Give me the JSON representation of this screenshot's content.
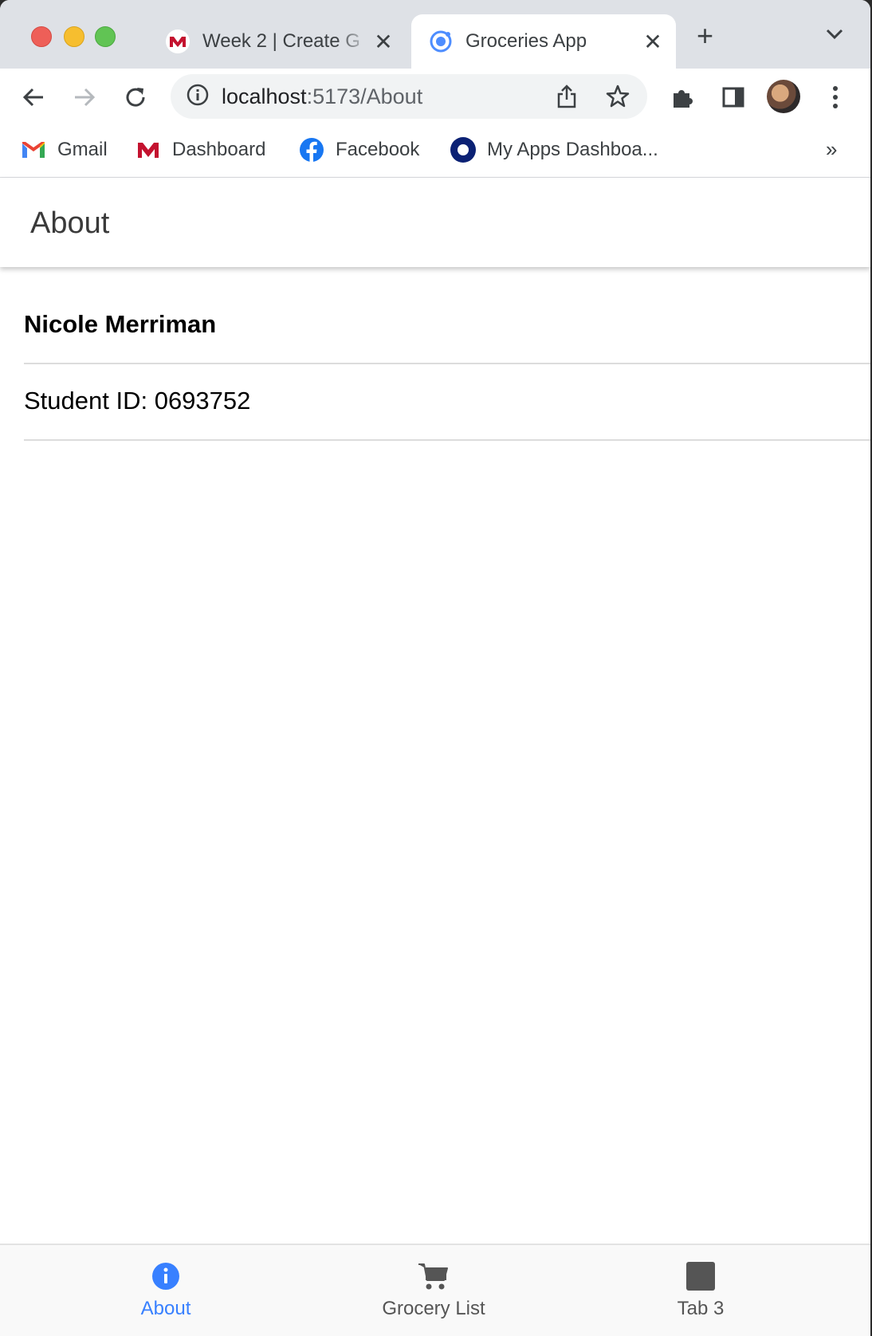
{
  "browser": {
    "tabs": [
      {
        "title": "Week 2 | Create G",
        "favicon": "mheducation-icon",
        "active": false
      },
      {
        "title": "Groceries App",
        "favicon": "ionic-icon",
        "active": true
      }
    ],
    "url": {
      "host": "localhost",
      "rest": ":5173/About"
    },
    "bookmarks": [
      {
        "label": "Gmail",
        "icon": "gmail-icon"
      },
      {
        "label": "Dashboard",
        "icon": "mheducation-icon"
      },
      {
        "label": "Facebook",
        "icon": "facebook-icon"
      },
      {
        "label": "My Apps Dashboa...",
        "icon": "okta-icon"
      }
    ],
    "bookmarks_more": "»"
  },
  "app": {
    "header_title": "About",
    "name": "Nicole Merriman",
    "student_id": "Student ID: 0693752",
    "tabs": [
      {
        "label": "About",
        "icon": "info-icon",
        "active": true
      },
      {
        "label": "Grocery List",
        "icon": "cart-icon",
        "active": false
      },
      {
        "label": "Tab 3",
        "icon": "square-icon",
        "active": false
      }
    ]
  },
  "colors": {
    "accent": "#3880ff",
    "tab_strip": "#dee1e6",
    "omnibox": "#f1f3f4"
  }
}
